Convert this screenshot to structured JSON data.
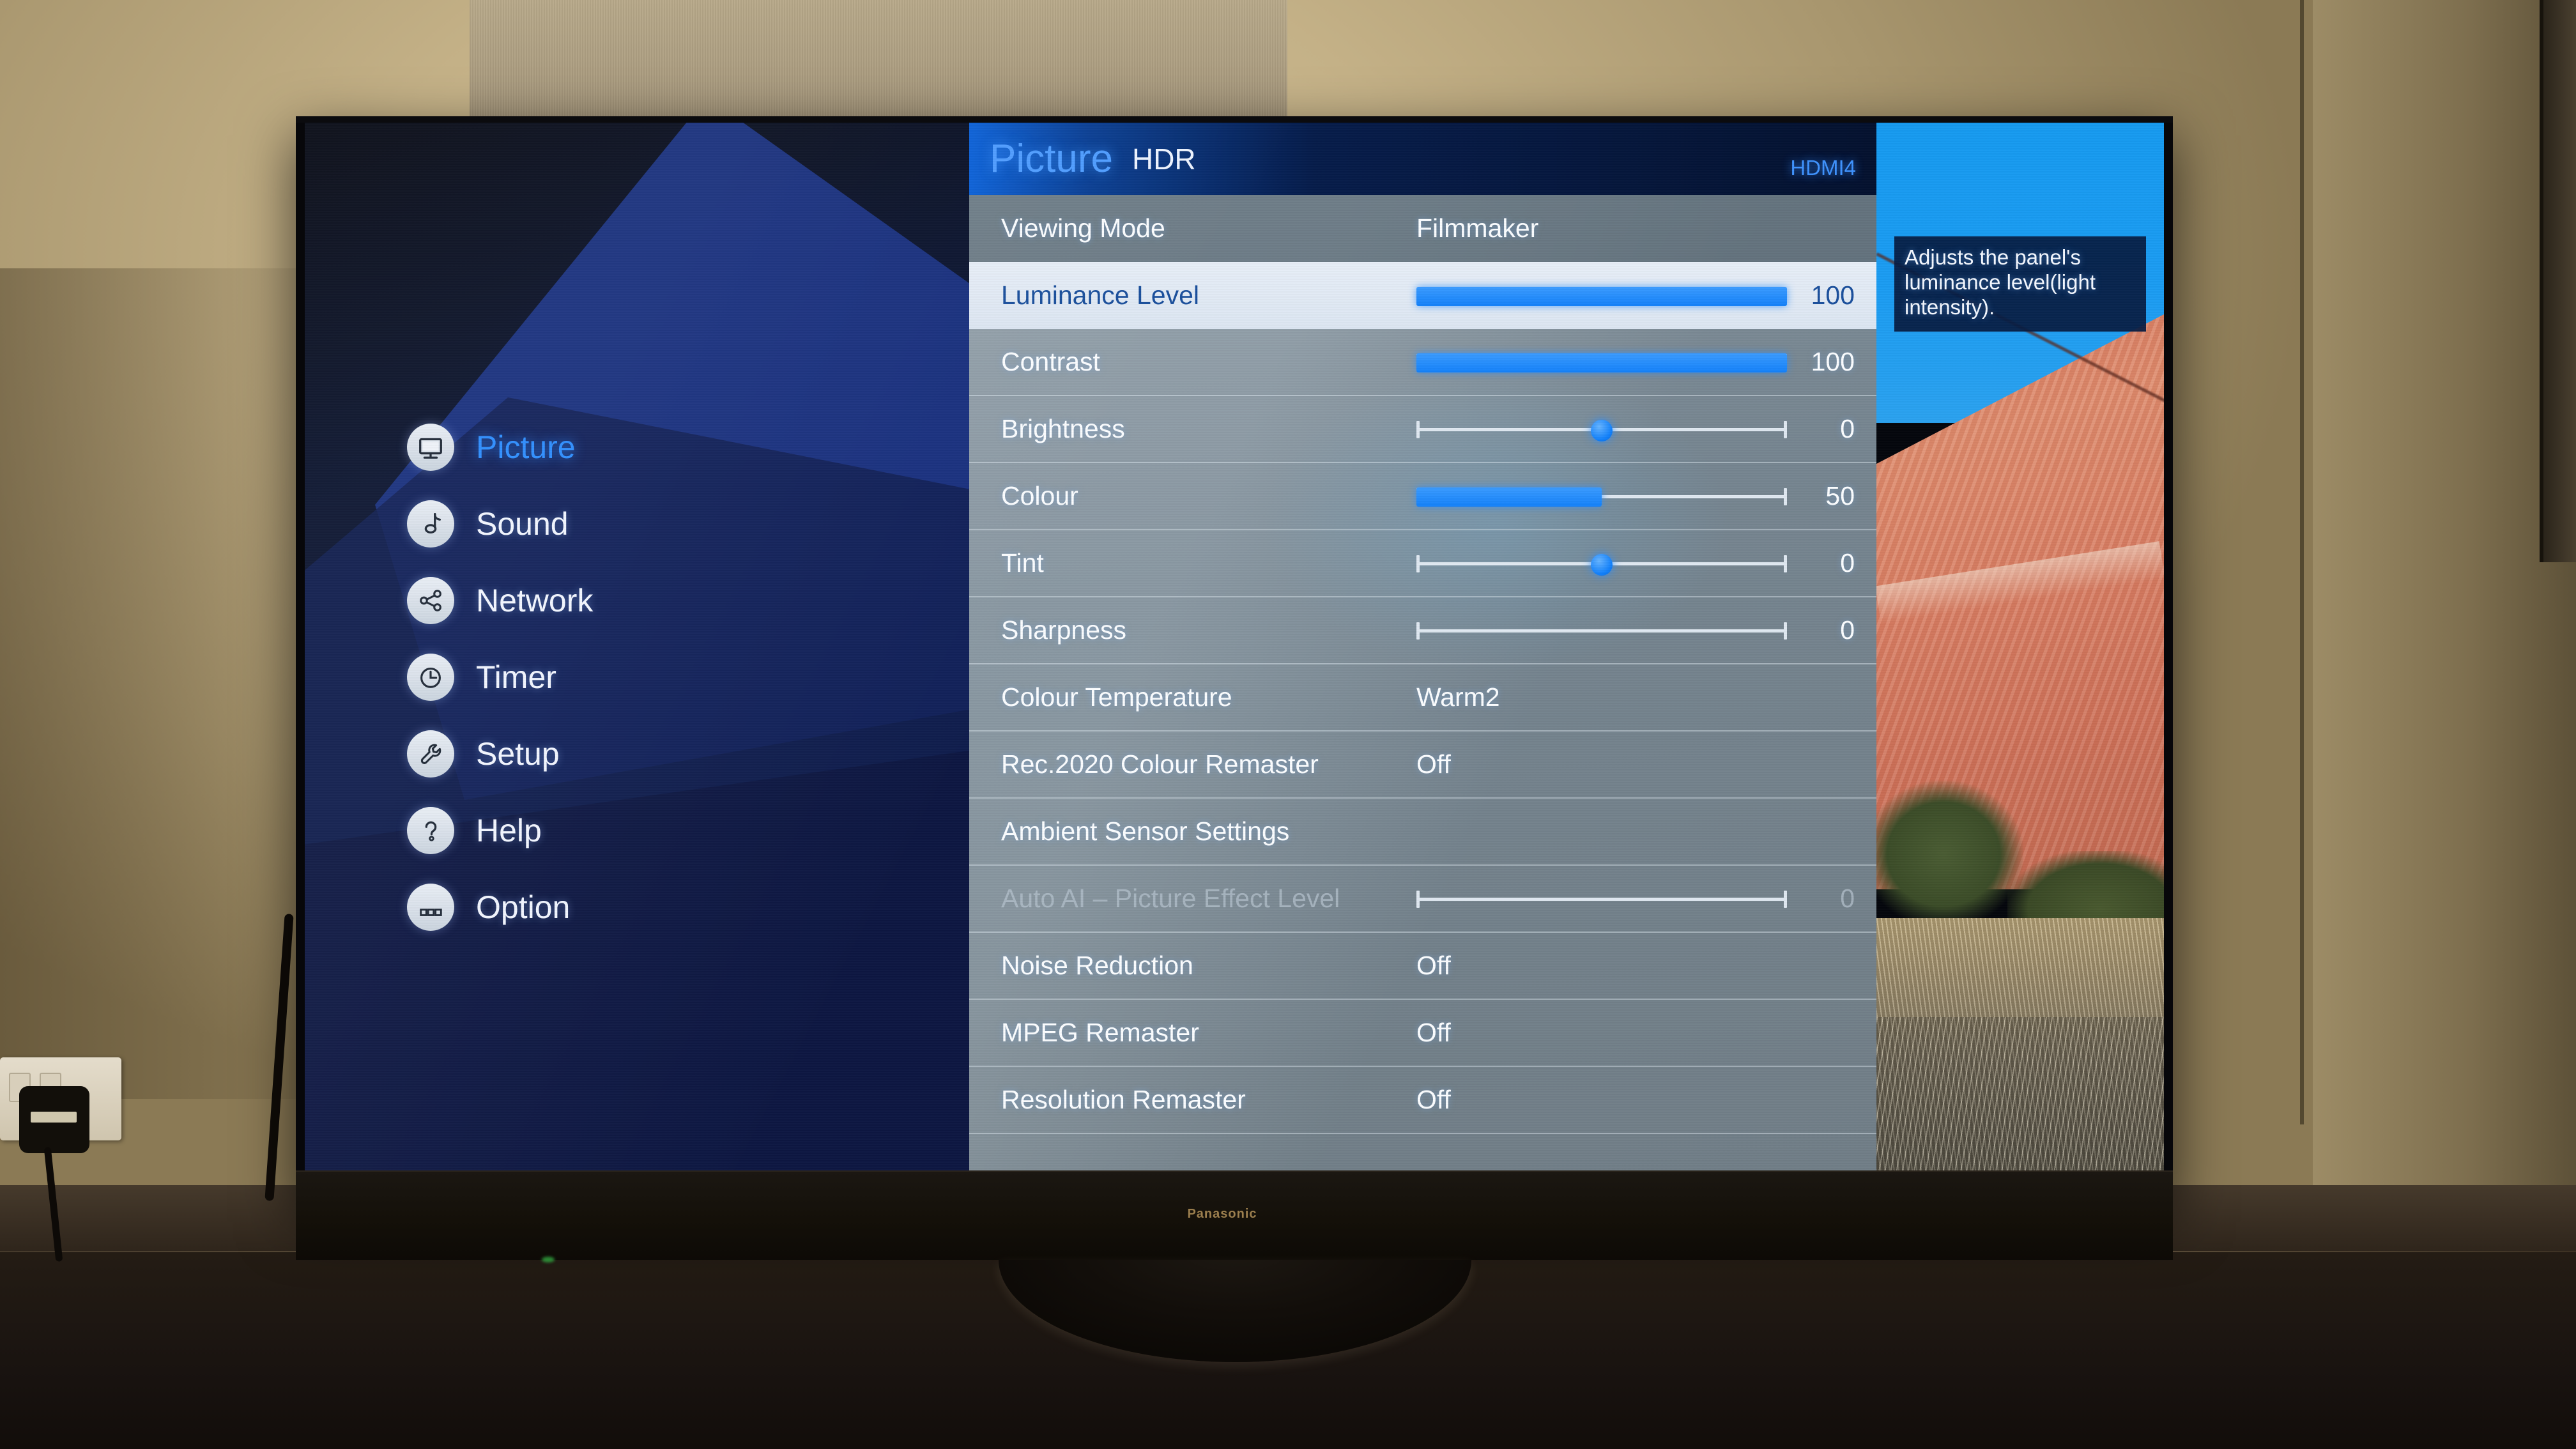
{
  "device": {
    "brand": "Panasonic"
  },
  "header": {
    "title": "Picture",
    "subtitle": "HDR",
    "source": "HDMI4"
  },
  "sidebar": {
    "items": [
      {
        "label": "Picture",
        "icon": "tv-icon",
        "active": true
      },
      {
        "label": "Sound",
        "icon": "music-note-icon",
        "active": false
      },
      {
        "label": "Network",
        "icon": "share-nodes-icon",
        "active": false
      },
      {
        "label": "Timer",
        "icon": "clock-icon",
        "active": false
      },
      {
        "label": "Setup",
        "icon": "wrench-icon",
        "active": false
      },
      {
        "label": "Help",
        "icon": "question-mark-icon",
        "active": false
      },
      {
        "label": "Option",
        "icon": "three-squares-icon",
        "active": false
      }
    ]
  },
  "settings": {
    "rows": [
      {
        "label": "Viewing Mode",
        "value": "Filmmaker",
        "type": "value",
        "state": "mode"
      },
      {
        "label": "Luminance Level",
        "number": "100",
        "type": "bar",
        "fill": 100,
        "state": "selected"
      },
      {
        "label": "Contrast",
        "number": "100",
        "type": "bar",
        "fill": 100,
        "state": "normal"
      },
      {
        "label": "Brightness",
        "number": "0",
        "type": "knob",
        "pos": 50,
        "state": "normal"
      },
      {
        "label": "Colour",
        "number": "50",
        "type": "bar",
        "fill": 50,
        "state": "normal"
      },
      {
        "label": "Tint",
        "number": "0",
        "type": "knob",
        "pos": 50,
        "state": "normal"
      },
      {
        "label": "Sharpness",
        "number": "0",
        "type": "track",
        "fill": 0,
        "state": "normal"
      },
      {
        "label": "Colour Temperature",
        "value": "Warm2",
        "type": "value",
        "state": "normal"
      },
      {
        "label": "Rec.2020 Colour Remaster",
        "value": "Off",
        "type": "value",
        "state": "normal"
      },
      {
        "label": "Ambient Sensor Settings",
        "value": "",
        "type": "value",
        "state": "normal"
      },
      {
        "label": "Auto AI – Picture Effect Level",
        "number": "0",
        "type": "track",
        "fill": 0,
        "state": "disabled"
      },
      {
        "label": "Noise Reduction",
        "value": "Off",
        "type": "value",
        "state": "normal"
      },
      {
        "label": "MPEG Remaster",
        "value": "Off",
        "type": "value",
        "state": "normal"
      },
      {
        "label": "Resolution Remaster",
        "value": "Off",
        "type": "value",
        "state": "normal"
      }
    ]
  },
  "tooltip": {
    "text": "Adjusts the panel's luminance level(light intensity)."
  },
  "colors": {
    "accent_blue": "#1381fa",
    "title_blue": "#4f9dff",
    "selected_row_bg": "#e7eef7",
    "panel_gray": "#7d8d99",
    "header_dark": "#04112f"
  }
}
